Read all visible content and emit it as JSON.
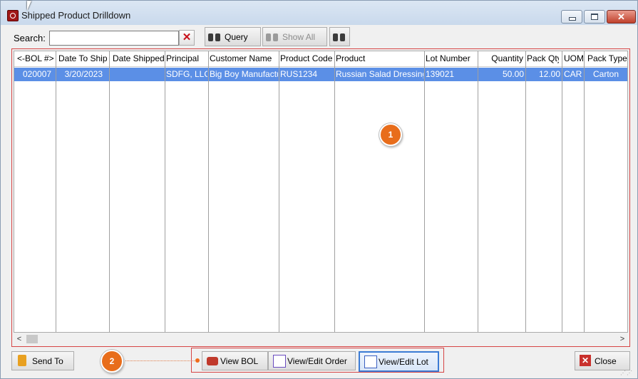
{
  "window": {
    "title": "Shipped Product Drilldown"
  },
  "search": {
    "label": "Search:",
    "value": "",
    "placeholder": ""
  },
  "toolbar": {
    "query_label": "Query",
    "show_all_label": "Show All"
  },
  "table": {
    "columns": [
      "<-BOL #>",
      "Date To Ship",
      "Date Shipped",
      "Principal",
      "Customer Name",
      "Product Code",
      "Product",
      "Lot Number",
      "Quantity",
      "Pack Qty",
      "UOM",
      "Pack Type"
    ],
    "rows": [
      {
        "bol": "020007",
        "date_to_ship": "3/20/2023",
        "date_shipped": "",
        "principal": "SDFG, LLC",
        "customer_name": "Big Boy Manufacturi",
        "product_code": "RUS1234",
        "product": "Russian Salad Dressing",
        "lot_number": "139021",
        "quantity": "50.00",
        "pack_qty": "12.00",
        "uom": "CAR",
        "pack_type": "Carton"
      }
    ]
  },
  "badges": {
    "one": "1",
    "two": "2"
  },
  "bottom": {
    "send_to_label": "Send To",
    "view_bol_label": "View BOL",
    "view_edit_order_label": "View/Edit Order",
    "view_edit_lot_label": "View/Edit Lot",
    "close_label": "Close"
  },
  "colors": {
    "selection": "#5b8fe6",
    "callout": "#e86d1b",
    "highlight_frame": "#d64545"
  }
}
